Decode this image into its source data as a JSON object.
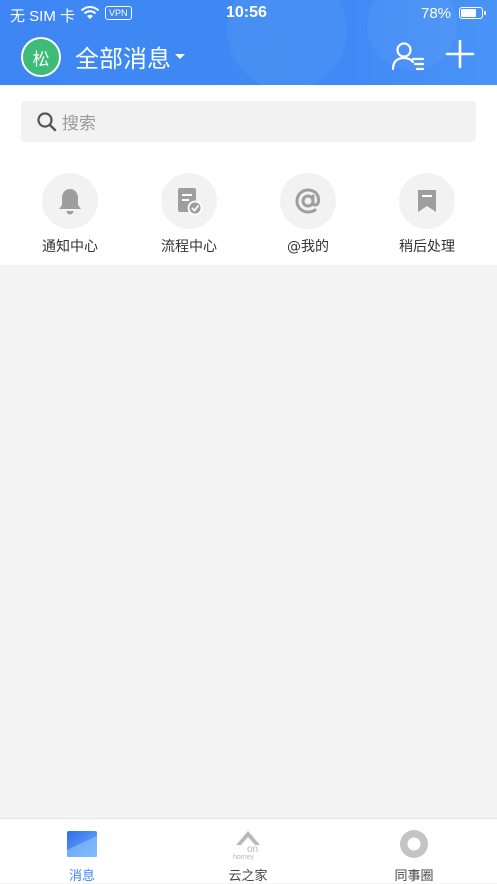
{
  "status_bar": {
    "carrier": "无 SIM 卡",
    "vpn": "VPN",
    "time": "10:56",
    "battery_pct": "78%",
    "battery_level": 0.78
  },
  "header": {
    "avatar_text": "松",
    "title": "全部消息",
    "contacts_icon": "contacts-icon",
    "add_icon": "plus-icon"
  },
  "search": {
    "placeholder": "搜索"
  },
  "shortcuts": [
    {
      "label": "通知中心",
      "icon": "bell-icon"
    },
    {
      "label": "流程中心",
      "icon": "approval-doc-icon"
    },
    {
      "label": "@我的",
      "icon": "at-icon"
    },
    {
      "label": "稍后处理",
      "icon": "bookmark-icon"
    }
  ],
  "tabbar": [
    {
      "label": "消息",
      "icon": "message-icon",
      "active": true
    },
    {
      "label": "云之家",
      "icon": "yunzhijia-icon",
      "active": false,
      "icon_text": "on",
      "icon_subtext": "homey"
    },
    {
      "label": "同事圈",
      "icon": "colleague-circle-icon",
      "active": false
    }
  ],
  "colors": {
    "header_blue": "#3d86f3",
    "avatar_green": "#3dbb77",
    "icon_gray": "#9e9e9e",
    "background": "#f4f4f4"
  }
}
